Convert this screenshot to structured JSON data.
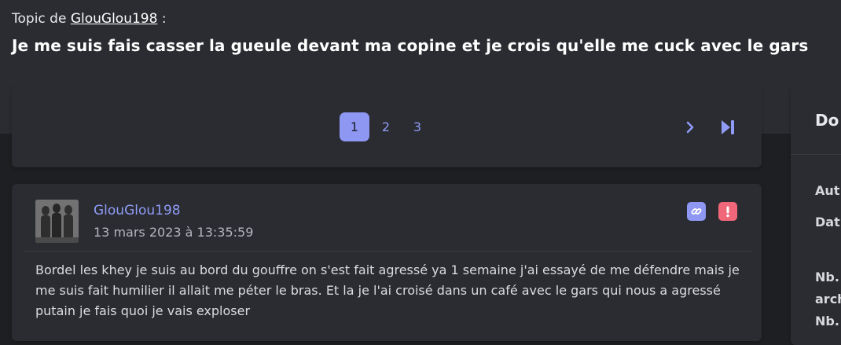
{
  "header": {
    "topic_prefix": "Topic de",
    "topic_author": "GlouGlou198",
    "topic_suffix": ":",
    "title": "Je me suis fais casser la gueule devant ma copine et je crois qu'elle me cuck avec le gars"
  },
  "pagination": {
    "pages": [
      "1",
      "2",
      "3"
    ],
    "current_page": "1",
    "next_icon": "chevron-right-icon",
    "last_icon": "skip-to-last-icon"
  },
  "post": {
    "author": "GlouGlou198",
    "date": "13 mars 2023 à 13:35:59",
    "permalink_icon": "link-icon",
    "report_icon": "exclamation-icon",
    "body": "Bordel les khey je suis au bord du gouffre on s'est fait agressé ya 1 semaine j'ai essayé de me défendre mais je me suis fait humilier il allait me péter le bras. Et la je l'ai croisé dans un café avec le gars qui nous a agressé putain je fais quoi je vais exploser"
  },
  "sidebar": {
    "title": "Do",
    "labels": [
      "Aut",
      "Dat",
      "Nb.",
      "arch",
      "Nb."
    ]
  },
  "colors": {
    "accent": "#8e97f2",
    "danger": "#f0677a",
    "background": "#1e1f22",
    "card": "#2a2c31"
  }
}
